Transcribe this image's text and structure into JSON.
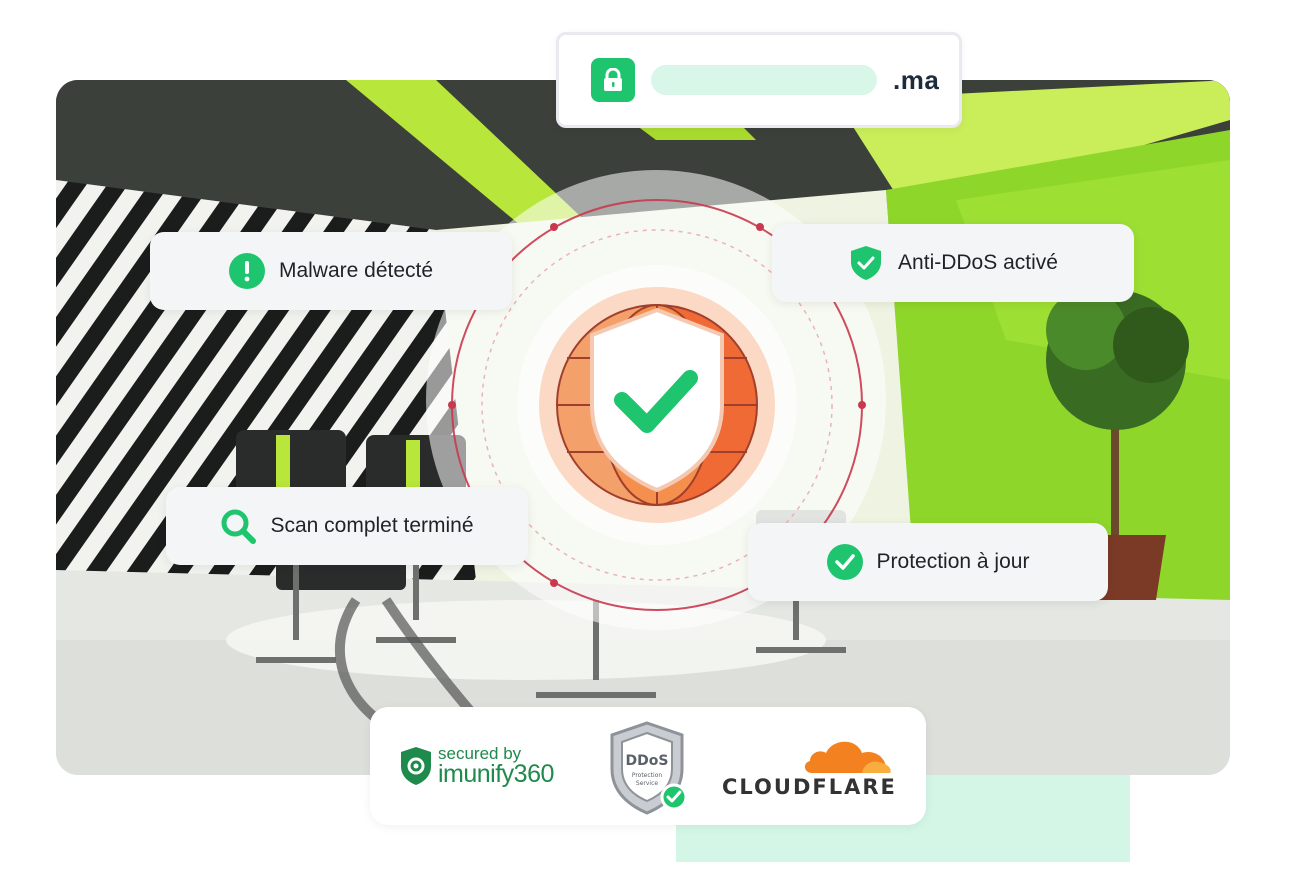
{
  "url_bar": {
    "tld": ".ma",
    "lock_icon": "lock-icon"
  },
  "cards": {
    "malware": {
      "label": "Malware détecté",
      "icon": "exclamation-icon",
      "color": "#1fc46e"
    },
    "ddos": {
      "label": "Anti-DDoS activé",
      "icon": "shield-check-icon",
      "color": "#1fc46e"
    },
    "scan": {
      "label": "Scan complet terminé",
      "icon": "search-icon",
      "color": "#1fc46e"
    },
    "protection": {
      "label": "Protection à jour",
      "icon": "check-circle-icon",
      "color": "#1fc46e"
    }
  },
  "badges": {
    "imunify_line1": "secured by",
    "imunify_line2": "imunify360",
    "ddos_badge_title": "DDoS",
    "ddos_badge_sub": "Protection Service",
    "cloudflare": "CLOUDFLARE"
  },
  "colors": {
    "accent_green": "#1fc46e",
    "globe_orange": "#f2753a",
    "mint": "#d3f6e6"
  }
}
